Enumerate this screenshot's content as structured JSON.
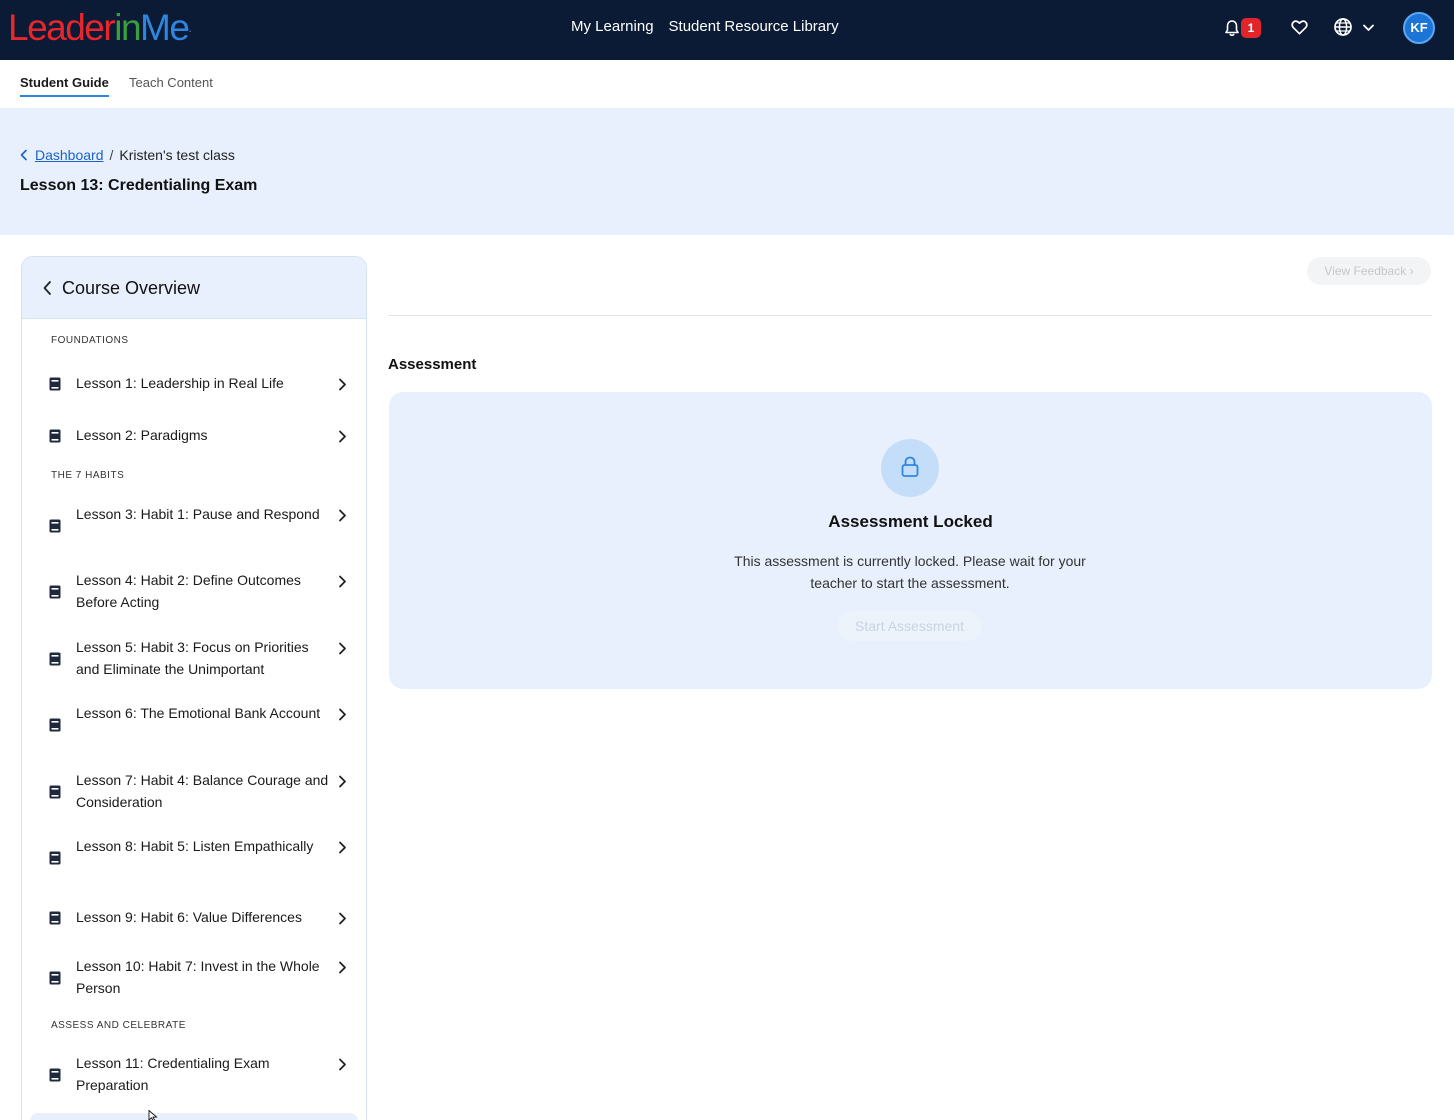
{
  "brand": {
    "logo_leader": "Leader",
    "logo_in": "in",
    "logo_me": "Me",
    "logo_dot": "."
  },
  "topnav": {
    "links": [
      "My Learning",
      "Student Resource Library"
    ],
    "notification_count": "1",
    "avatar_initials": "KF"
  },
  "subtabs": {
    "student_guide": "Student Guide",
    "teach_content": "Teach Content"
  },
  "header": {
    "breadcrumb_link": "Dashboard",
    "breadcrumb_sep": "/",
    "breadcrumb_current": "Kristen's test class",
    "page_title": "Lesson 13: Credentialing Exam"
  },
  "sidebar": {
    "title": "Course Overview",
    "sections": {
      "foundations": "FOUNDATIONS",
      "habits": "THE 7 HABITS",
      "assess": "ASSESS AND CELEBRATE"
    },
    "lessons": [
      "Lesson 1: Leadership in Real Life",
      "Lesson 2: Paradigms",
      "Lesson 3: Habit 1: Pause and Respond",
      "Lesson 4: Habit 2: Define Outcomes Before Acting",
      "Lesson 5: Habit 3: Focus on Priorities and Eliminate the Unimportant",
      "Lesson 6: The Emotional Bank Account",
      "Lesson 7: Habit 4: Balance Courage and Consideration",
      "Lesson 8: Habit 5: Listen Empathically",
      "Lesson 9: Habit 6: Value Differences",
      "Lesson 10: Habit 7: Invest in the Whole Person",
      "Lesson 11: Credentialing Exam Preparation"
    ]
  },
  "main": {
    "view_feedback": "View Feedback",
    "section_title": "Assessment",
    "locked_title": "Assessment Locked",
    "locked_message": "This assessment is currently locked. Please wait for your teacher to start the assessment.",
    "start_button": "Start Assessment"
  },
  "colors": {
    "nav_bg": "#0b1b35",
    "accent": "#2f86de",
    "band_bg": "#e7f0fc",
    "badge": "#e0262b"
  }
}
